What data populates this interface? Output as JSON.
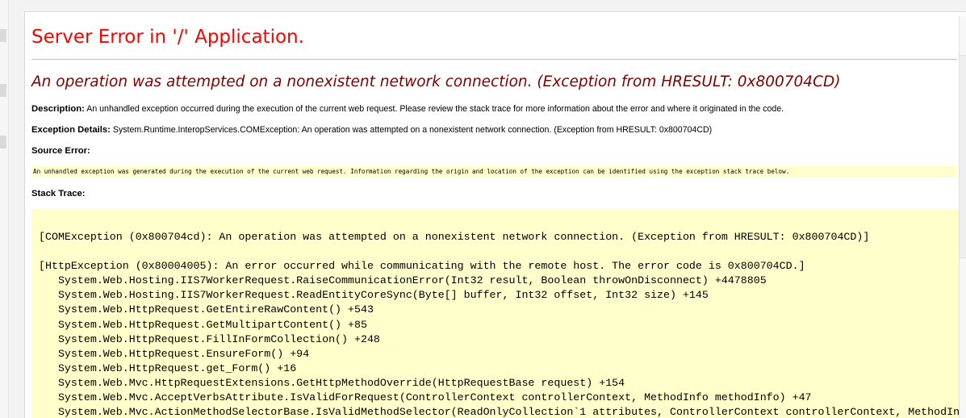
{
  "error_page": {
    "title": "Server Error in '/' Application.",
    "message": "An operation was attempted on a nonexistent network connection. (Exception from HRESULT: 0x800704CD)",
    "description_label": "Description:",
    "description_text": " An unhandled exception occurred during the execution of the current web request. Please review the stack trace for more information about the error and where it originated in the code.",
    "exception_label": "Exception Details:",
    "exception_text": " System.Runtime.InteropServices.COMException: An operation was attempted on a nonexistent network connection. (Exception from HRESULT: 0x800704CD)",
    "source_error_label": "Source Error:",
    "source_error_text": "An unhandled exception was generated during the execution of the current web request. Information regarding the origin and location of the exception can be identified using the exception stack trace below.",
    "stack_trace_label": "Stack Trace:",
    "stack_trace_lines": [
      "[COMException (0x800704cd): An operation was attempted on a nonexistent network connection. (Exception from HRESULT: 0x800704CD)]",
      "",
      "[HttpException (0x80004005): An error occurred while communicating with the remote host. The error code is 0x800704CD.]",
      "   System.Web.Hosting.IIS7WorkerRequest.RaiseCommunicationError(Int32 result, Boolean throwOnDisconnect) +4478805",
      "   System.Web.Hosting.IIS7WorkerRequest.ReadEntityCoreSync(Byte[] buffer, Int32 offset, Int32 size) +145",
      "   System.Web.HttpRequest.GetEntireRawContent() +543",
      "   System.Web.HttpRequest.GetMultipartContent() +85",
      "   System.Web.HttpRequest.FillInFormCollection() +248",
      "   System.Web.HttpRequest.EnsureForm() +94",
      "   System.Web.HttpRequest.get_Form() +16",
      "   System.Web.Mvc.HttpRequestExtensions.GetHttpMethodOverride(HttpRequestBase request) +154",
      "   System.Web.Mvc.AcceptVerbsAttribute.IsValidForRequest(ControllerContext controllerContext, MethodInfo methodInfo) +47",
      "   System.Web.Mvc.ActionMethodSelectorBase.IsValidMethodSelector(ReadOnlyCollection`1 attributes, ControllerContext controllerContext, MethodIn"
    ]
  }
}
